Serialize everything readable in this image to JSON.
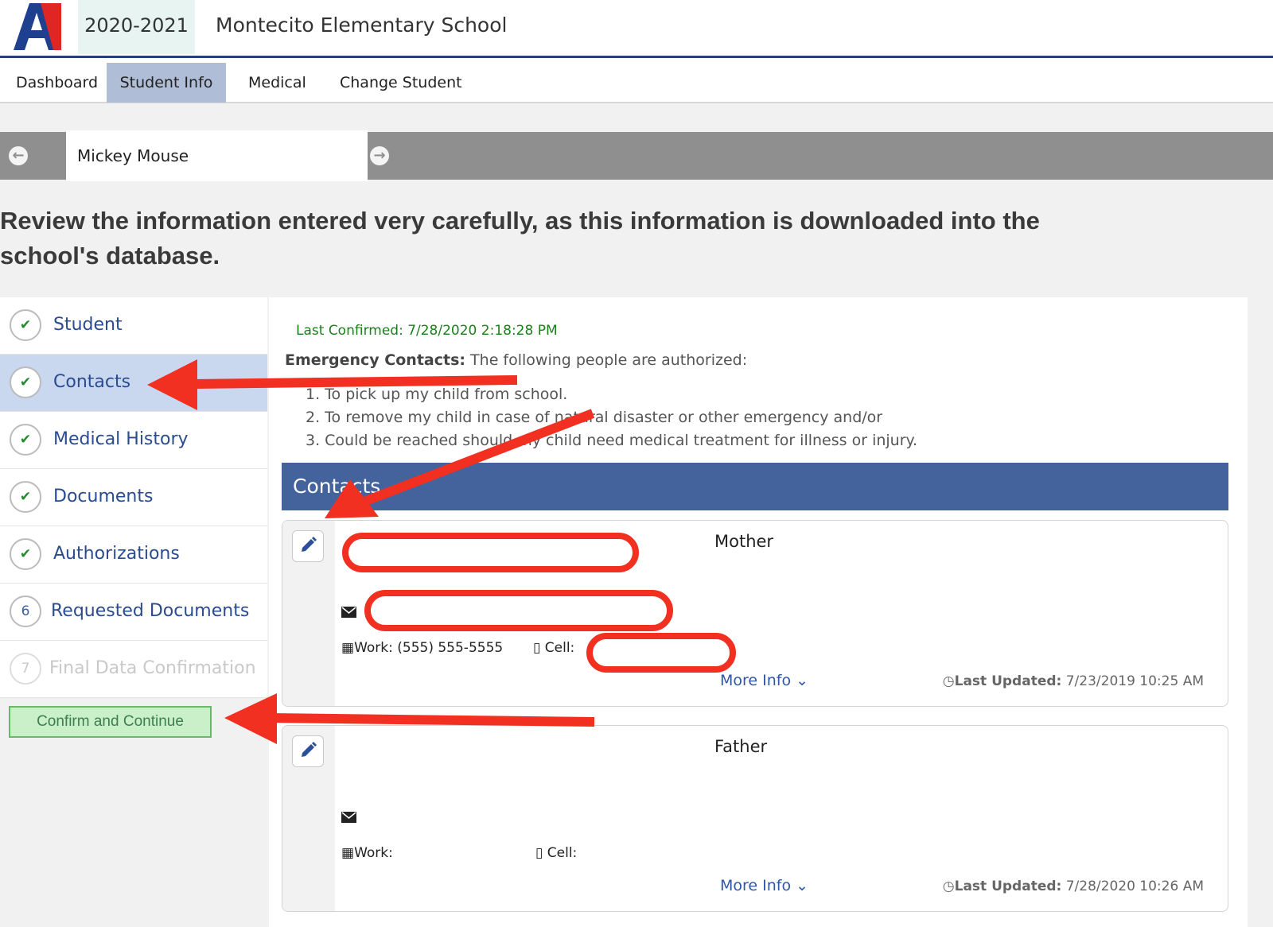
{
  "header": {
    "logo_letter": "A",
    "year": "2020-2021",
    "school": "Montecito Elementary School"
  },
  "nav": [
    "Dashboard",
    "Student Info",
    "Medical",
    "Change Student"
  ],
  "student": {
    "name": "Mickey Mouse"
  },
  "review_text": "Review the information entered very carefully, as this information is downloaded into the school's database.",
  "steps": [
    {
      "label": "Student",
      "status": "✔"
    },
    {
      "label": "Contacts",
      "status": "✔"
    },
    {
      "label": "Medical History",
      "status": "✔"
    },
    {
      "label": "Documents",
      "status": "✔"
    },
    {
      "label": "Authorizations",
      "status": "✔"
    },
    {
      "label": "Requested Documents",
      "status": "6"
    },
    {
      "label": "Final Data Confirmation",
      "status": "7"
    }
  ],
  "confirm_button": "Confirm and Continue",
  "main": {
    "last_confirmed": "Last Confirmed: 7/28/2020 2:18:28 PM",
    "emergency_title": "Emergency Contacts:",
    "emergency_text": " The following people are authorized:",
    "reasons": [
      "1. To pick up my child from school.",
      "2. To remove my child in case of natural disaster or other emergency and/or",
      "3. Could be reached should my child need medical treatment for illness or injury."
    ],
    "contacts_header": "Contacts"
  },
  "contacts": [
    {
      "relation": "Mother",
      "work": "Work: (555) 555-5555",
      "cell": "Cell:",
      "more": "More Info ⌄",
      "updated_label": "Last Updated:",
      "updated": "7/23/2019 10:25 AM"
    },
    {
      "relation": "Father",
      "work": "Work:",
      "cell": "Cell:",
      "more": "More Info ⌄",
      "updated_label": "Last Updated:",
      "updated": "7/28/2020 10:26 AM"
    }
  ],
  "colors": {
    "brand_blue": "#23407a",
    "header_blue": "#44629c",
    "annotation_red": "#f13021",
    "confirm_green": "#c9f0c9"
  }
}
